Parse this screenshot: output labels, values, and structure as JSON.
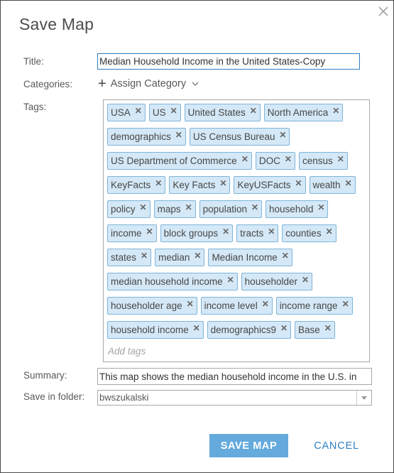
{
  "dialog": {
    "title": "Save Map",
    "close_icon": "close-icon"
  },
  "form": {
    "title_label": "Title:",
    "title_value": "Median Household Income in the United States-Copy",
    "categories_label": "Categories:",
    "assign_category_label": "Assign Category",
    "tags_label": "Tags:",
    "tags": [
      "USA",
      "US",
      "United States",
      "North America",
      "demographics",
      "US Census Bureau",
      "US Department of Commerce",
      "DOC",
      "census",
      "KeyFacts",
      "Key Facts",
      "KeyUSFacts",
      "wealth",
      "policy",
      "maps",
      "population",
      "household",
      "income",
      "block groups",
      "tracts",
      "counties",
      "states",
      "median",
      "Median Income",
      "median household income",
      "householder",
      "householder age",
      "income level",
      "income range",
      "household income",
      "demographics9",
      "Base"
    ],
    "tag_remove_glyph": "✕",
    "add_tags_placeholder": "Add tags",
    "summary_label": "Summary:",
    "summary_value": "This map shows the median household income in the U.S. in",
    "folder_label": "Save in folder:",
    "folder_value": "bwszukalski"
  },
  "buttons": {
    "save": "SAVE MAP",
    "cancel": "CANCEL"
  },
  "colors": {
    "accent": "#2f7fc1",
    "save_button": "#65aadc",
    "tag_background": "#d4e8f7",
    "tag_border": "#7fb4d9"
  }
}
